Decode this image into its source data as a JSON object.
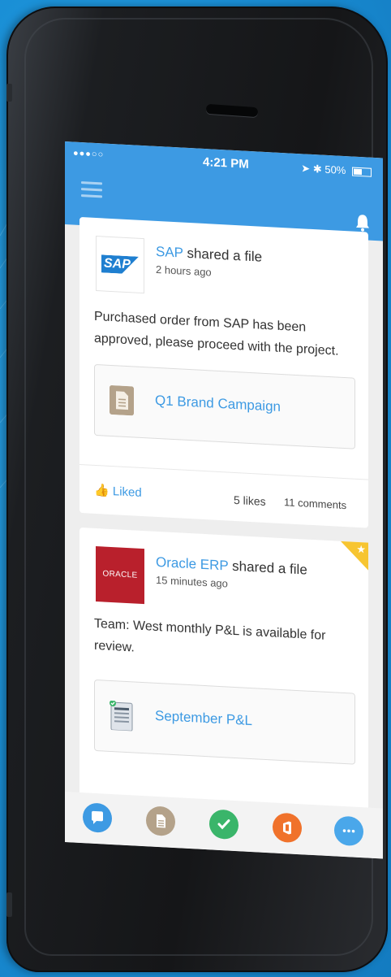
{
  "status_bar": {
    "signal": "●●●○○",
    "time": "4:21 PM",
    "battery": "50%"
  },
  "feed": [
    {
      "source": "SAP",
      "action": " shared a file",
      "ago": "2 hours ago",
      "logo_text": "SAP",
      "message": "Purchased order from SAP has been approved, please proceed with the project.",
      "file": "Q1 Brand Campaign",
      "liked_label": "Liked",
      "likes": "5 likes",
      "comments": "11 comments"
    },
    {
      "source": "Oracle ERP",
      "action": " shared a file",
      "ago": "15 minutes ago",
      "logo_text": "ORACLE",
      "message": "Team: West monthly P&L is available for review.",
      "file": "September P&L",
      "starred": true
    }
  ],
  "tabs": [
    {
      "icon": "chat-icon",
      "color": "#3d9ae3"
    },
    {
      "icon": "document-icon",
      "color": "#b4a28a"
    },
    {
      "icon": "check-icon",
      "color": "#3ab56a"
    },
    {
      "icon": "office-icon",
      "color": "#f0722b"
    },
    {
      "icon": "more-icon",
      "color": "#4aa7ea"
    }
  ],
  "colors": {
    "accent": "#3d9ae3",
    "background": "#1a8fd6"
  }
}
